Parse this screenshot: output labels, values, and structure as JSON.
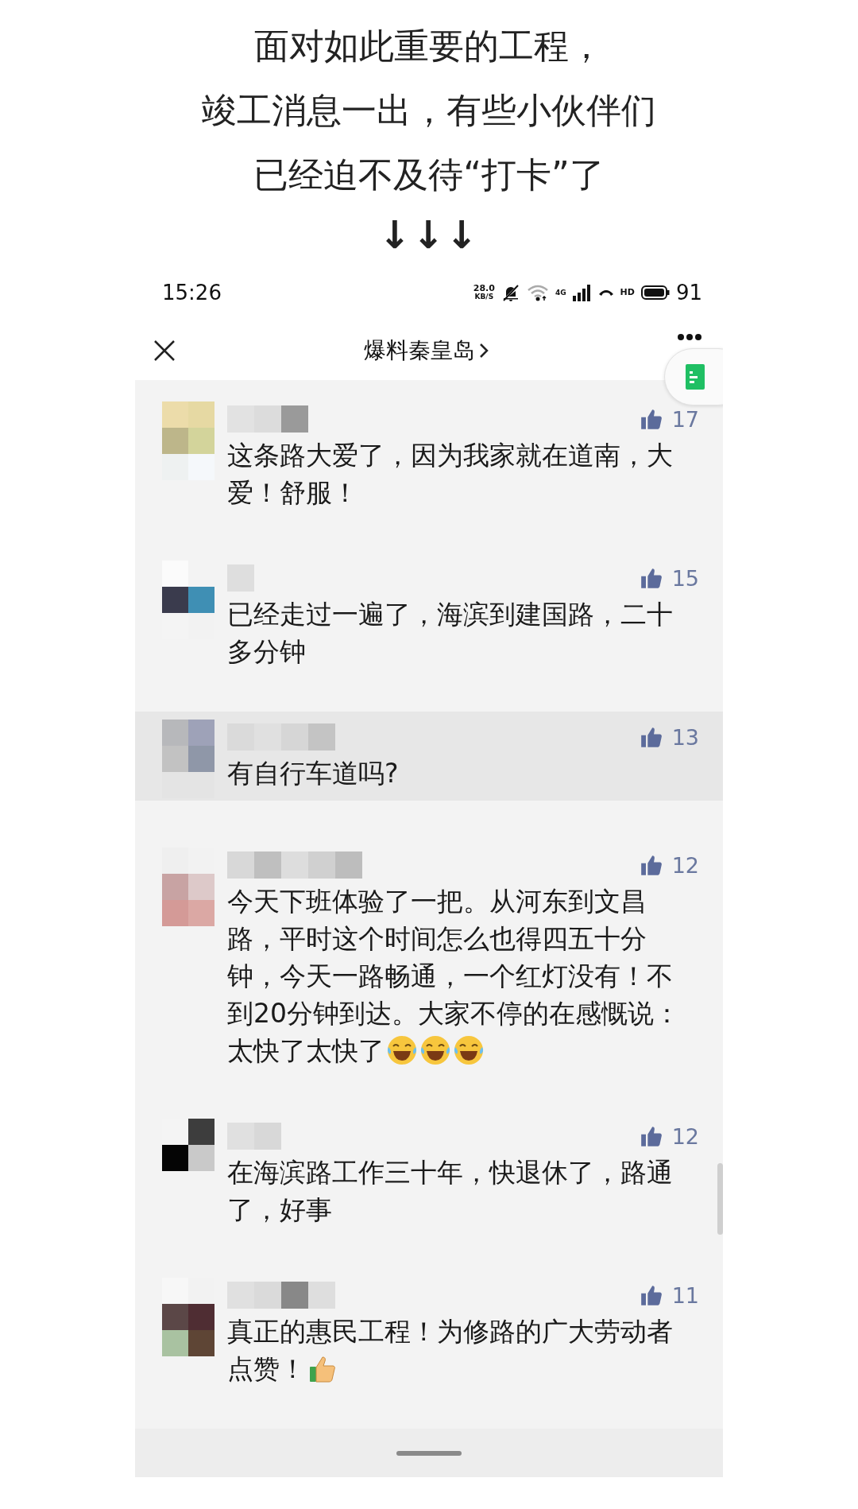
{
  "caption": {
    "lines": [
      "面对如此重要的工程，",
      "竣工消息一出，有些小伙伴们",
      "已经迫不及待“打卡”了"
    ],
    "arrows": "↓↓↓"
  },
  "status_bar": {
    "time": "15:26",
    "net_speed": "28.0",
    "net_speed_unit": "KB/S",
    "network_type": "4G",
    "call_badge": "HD",
    "battery": "91"
  },
  "header": {
    "title": "爆料秦皇岛"
  },
  "comments": [
    {
      "likes": "17",
      "text": "这条路大爱了，因为我家就在道南，大爱！舒服！",
      "highlighted": false
    },
    {
      "likes": "15",
      "text": "已经走过一遍了，海滨到建国路，二十多分钟",
      "highlighted": false
    },
    {
      "likes": "13",
      "text": "有自行车道吗?",
      "highlighted": true
    },
    {
      "likes": "12",
      "text": "今天下班体验了一把。从河东到文昌路，平时这个时间怎么也得四五十分钟，今天一路畅通，一个红灯没有！不到20分钟到达。大家不停的在感慨说：太快了太快了",
      "emojis": [
        {
          "kind": "laugh"
        },
        {
          "kind": "laugh"
        },
        {
          "kind": "laugh"
        }
      ],
      "highlighted": false
    },
    {
      "likes": "12",
      "text": "在海滨路工作三十年，快退休了，路通了，好事",
      "highlighted": false
    },
    {
      "likes": "11",
      "text": "真正的惠民工程！为修路的广大劳动者点赞！",
      "emojis": [
        {
          "kind": "thumbs_up"
        }
      ],
      "highlighted": false
    }
  ]
}
